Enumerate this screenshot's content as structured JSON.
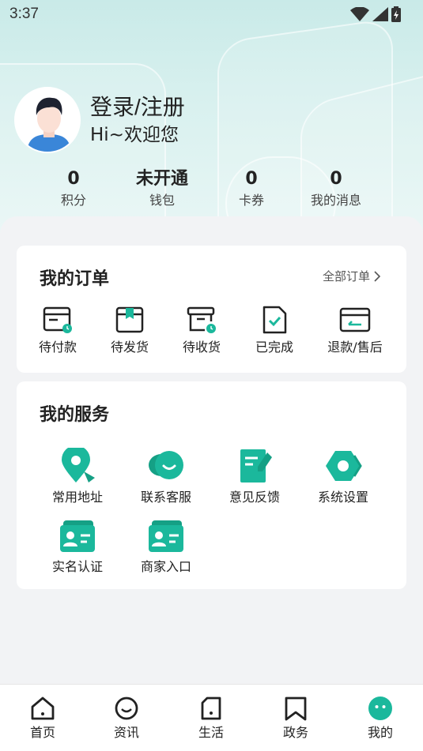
{
  "status_bar": {
    "time": "3:37"
  },
  "profile": {
    "login_label": "登录/注册",
    "welcome": "Hi~欢迎您"
  },
  "stats": [
    {
      "value": "0",
      "label": "积分"
    },
    {
      "value": "未开通",
      "label": "钱包"
    },
    {
      "value": "0",
      "label": "卡券"
    },
    {
      "value": "0",
      "label": "我的消息"
    }
  ],
  "orders": {
    "title": "我的订单",
    "all_label": "全部订单",
    "items": [
      {
        "label": "待付款",
        "icon": "wallet-clock-icon"
      },
      {
        "label": "待发货",
        "icon": "box-bookmark-icon"
      },
      {
        "label": "待收货",
        "icon": "box-clock-icon"
      },
      {
        "label": "已完成",
        "icon": "document-check-icon"
      },
      {
        "label": "退款/售后",
        "icon": "refund-card-icon"
      }
    ]
  },
  "services": {
    "title": "我的服务",
    "items": [
      {
        "label": "常用地址",
        "icon": "location-pin-icon"
      },
      {
        "label": "联系客服",
        "icon": "chat-smile-icon"
      },
      {
        "label": "意见反馈",
        "icon": "feedback-edit-icon"
      },
      {
        "label": "系统设置",
        "icon": "settings-hexagon-icon"
      },
      {
        "label": "实名认证",
        "icon": "id-card-icon"
      },
      {
        "label": "商家入口",
        "icon": "merchant-card-icon"
      }
    ]
  },
  "tabbar": [
    {
      "label": "首页",
      "icon": "home-icon",
      "active": false
    },
    {
      "label": "资讯",
      "icon": "news-icon",
      "active": false
    },
    {
      "label": "生活",
      "icon": "life-icon",
      "active": false
    },
    {
      "label": "政务",
      "icon": "government-icon",
      "active": false
    },
    {
      "label": "我的",
      "icon": "profile-face-icon",
      "active": true
    }
  ],
  "colors": {
    "accent": "#1bb89c",
    "header_bg": "#d3eeec",
    "text": "#222222"
  }
}
